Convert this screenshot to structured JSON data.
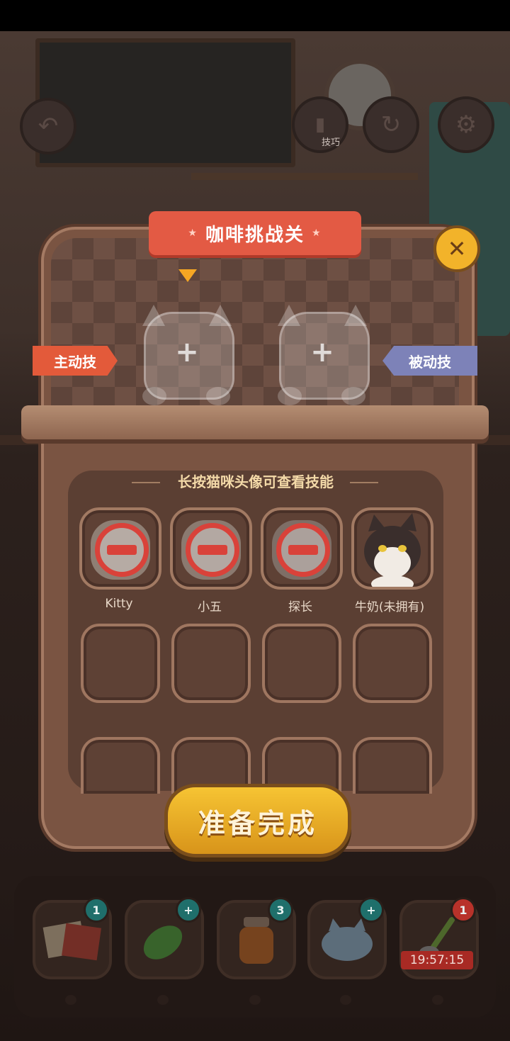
{
  "top_bar": {
    "back_icon": "back-arrow-icon",
    "tips_label": "技巧",
    "refresh_icon": "refresh-icon",
    "settings_icon": "gear-icon"
  },
  "dialog": {
    "title": "咖啡挑战关",
    "active_skill_label": "主动技",
    "passive_skill_label": "被动技",
    "slot_plus": "+",
    "hint": "长按猫咪头像可查看技能",
    "cats": [
      {
        "name": "Kitty",
        "locked": true
      },
      {
        "name": "小五",
        "locked": true
      },
      {
        "name": "探长",
        "locked": true
      },
      {
        "name": "牛奶(未拥有)",
        "locked": false
      }
    ],
    "ready_button": "准备完成",
    "close_icon": "close-icon"
  },
  "tray": {
    "items": [
      {
        "icon": "book-icon",
        "badge": "1",
        "badge_color": "#1f6f6b"
      },
      {
        "icon": "leaf-icon",
        "badge": "+",
        "badge_color": "#1f6f6b"
      },
      {
        "icon": "honey-jar-icon",
        "badge": "3",
        "badge_color": "#1f6f6b"
      },
      {
        "icon": "cat-cake-icon",
        "badge": "+",
        "badge_color": "#1f6f6b"
      },
      {
        "icon": "spoon-icon",
        "badge": "1",
        "badge_color": "#b8322a"
      }
    ],
    "timer": "19:57:15"
  },
  "colors": {
    "accent_red": "#e35a44",
    "accent_yellow": "#f6c433",
    "panel_brown": "#7a5442",
    "passive_purple": "#7d82b8"
  }
}
